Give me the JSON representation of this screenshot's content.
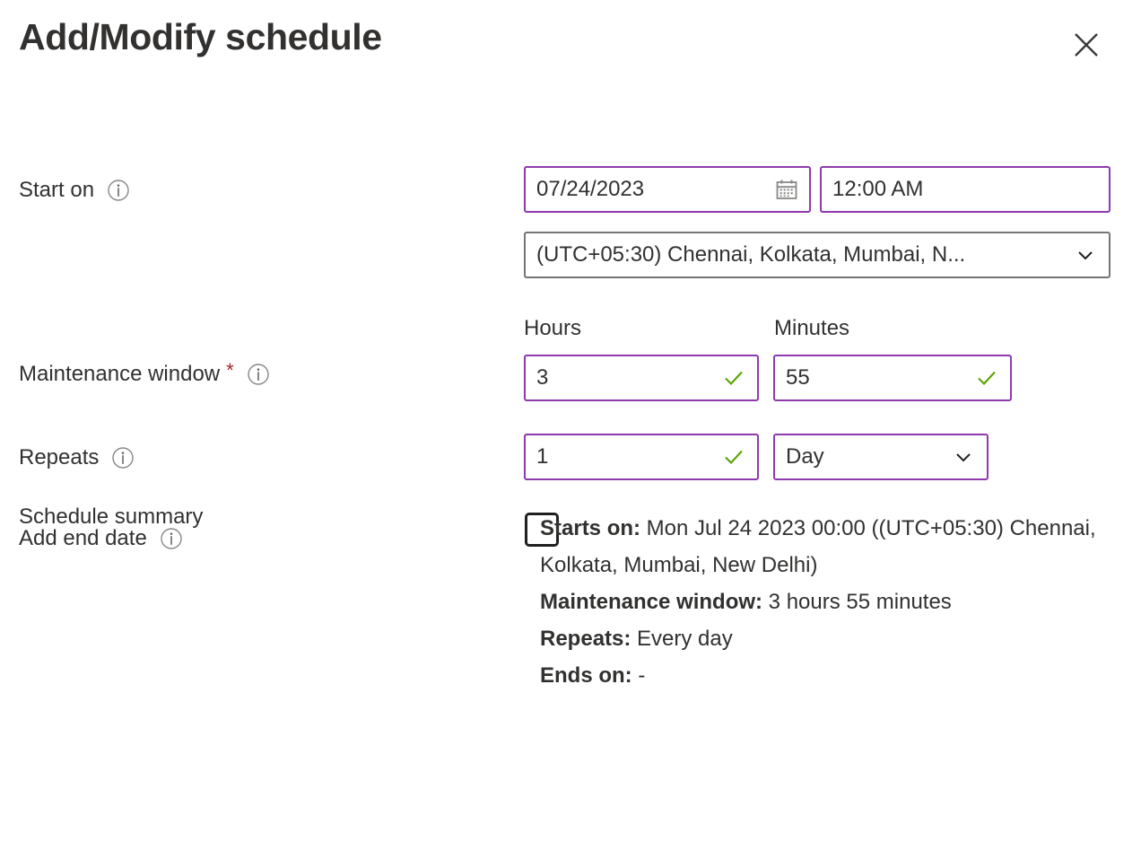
{
  "dialog": {
    "title": "Add/Modify schedule",
    "close_icon": "close-icon"
  },
  "fields": {
    "start_on": {
      "label": "Start on",
      "info_icon": "info-icon",
      "date_value": "07/24/2023",
      "date_icon": "calendar-icon",
      "time_value": "12:00 AM",
      "timezone_value": "(UTC+05:30) Chennai, Kolkata, Mumbai, N...",
      "timezone_chevron": "chevron-down-icon"
    },
    "maintenance_window": {
      "label": "Maintenance window",
      "required_mark": "*",
      "info_icon": "info-icon",
      "hours_header": "Hours",
      "minutes_header": "Minutes",
      "hours_value": "3",
      "minutes_value": "55",
      "hours_valid_icon": "check-icon",
      "minutes_valid_icon": "check-icon"
    },
    "repeats": {
      "label": "Repeats",
      "info_icon": "info-icon",
      "count_value": "1",
      "count_valid_icon": "check-icon",
      "unit_value": "Day",
      "unit_chevron": "chevron-down-icon"
    },
    "add_end_date": {
      "label": "Add end date",
      "info_icon": "info-icon",
      "checked": false
    }
  },
  "summary": {
    "label": "Schedule summary",
    "lines": [
      {
        "key": "Starts on:",
        "value": " Mon Jul 24 2023 00:00 ((UTC+05:30) Chennai, Kolkata, Mumbai, New Delhi)"
      },
      {
        "key": "Maintenance window:",
        "value": " 3 hours 55 minutes"
      },
      {
        "key": "Repeats:",
        "value": " Every day"
      },
      {
        "key": "Ends on:",
        "value": " -"
      }
    ]
  },
  "colors": {
    "accent_purple": "#8e3aae",
    "border_gray": "#757575",
    "valid_green": "#5aa300",
    "required_red": "#a4262c",
    "text": "#323130"
  }
}
